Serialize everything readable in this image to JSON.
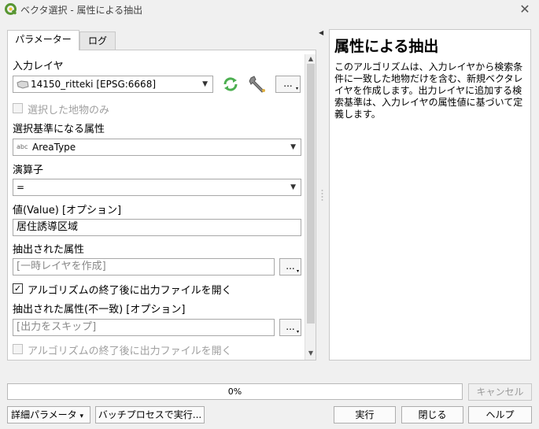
{
  "window": {
    "title": "ベクタ選択 - 属性による抽出",
    "close_glyph": "✕"
  },
  "tabs": [
    {
      "label": "パラメーター",
      "active": true
    },
    {
      "label": "ログ",
      "active": false
    }
  ],
  "params": {
    "input_layer_label": "入力レイヤ",
    "input_layer_value": "14150_ritteki [EPSG:6668]",
    "selected_only_label": "選択した地物のみ",
    "attribute_label": "選択基準になる属性",
    "attribute_type_tag": "abc",
    "attribute_value": "AreaType",
    "operator_label": "演算子",
    "operator_value": "=",
    "value_label": "値(Value) [オプション]",
    "value_value": "居住誘導区域",
    "extracted_label": "抽出された属性",
    "extracted_placeholder": "[一時レイヤを作成]",
    "open_after_label": "アルゴリズムの終了後に出力ファイルを開く",
    "open_after_checked": true,
    "nonmatching_label": "抽出された属性(不一致) [オプション]",
    "nonmatching_placeholder": "[出力をスキップ]",
    "open_after2_label": "アルゴリズムの終了後に出力ファイルを開く",
    "dots_label": "...",
    "dots_menu_glyph": "▾",
    "check_glyph": "✓",
    "combo_arrow_glyph": "▼"
  },
  "help": {
    "title": "属性による抽出",
    "body": "このアルゴリズムは、入力レイヤから検索条件に一致した地物だけを含む、新規ベクタレイヤを作成します。出力レイヤに追加する検索基準は、入力レイヤの属性値に基づいて定義します。"
  },
  "progress": {
    "value_text": "0%",
    "value": 0
  },
  "buttons": {
    "cancel": "キャンセル",
    "advanced": "詳細パラメータ",
    "advanced_arrow": "▾",
    "batch": "バッチプロセスで実行...",
    "run": "実行",
    "close": "閉じる",
    "help": "ヘルプ"
  },
  "glyphs": {
    "collapse_arrow": "◀",
    "scroll_up": "▲",
    "scroll_down": "▼"
  },
  "colors": {
    "qgis_green": "#589632",
    "refresh_green": "#4caf50",
    "wrench": "#8a8a8a"
  },
  "icons": [
    "qgis-logo-icon",
    "polygon-layer-icon",
    "refresh-icon",
    "wrench-icon"
  ]
}
